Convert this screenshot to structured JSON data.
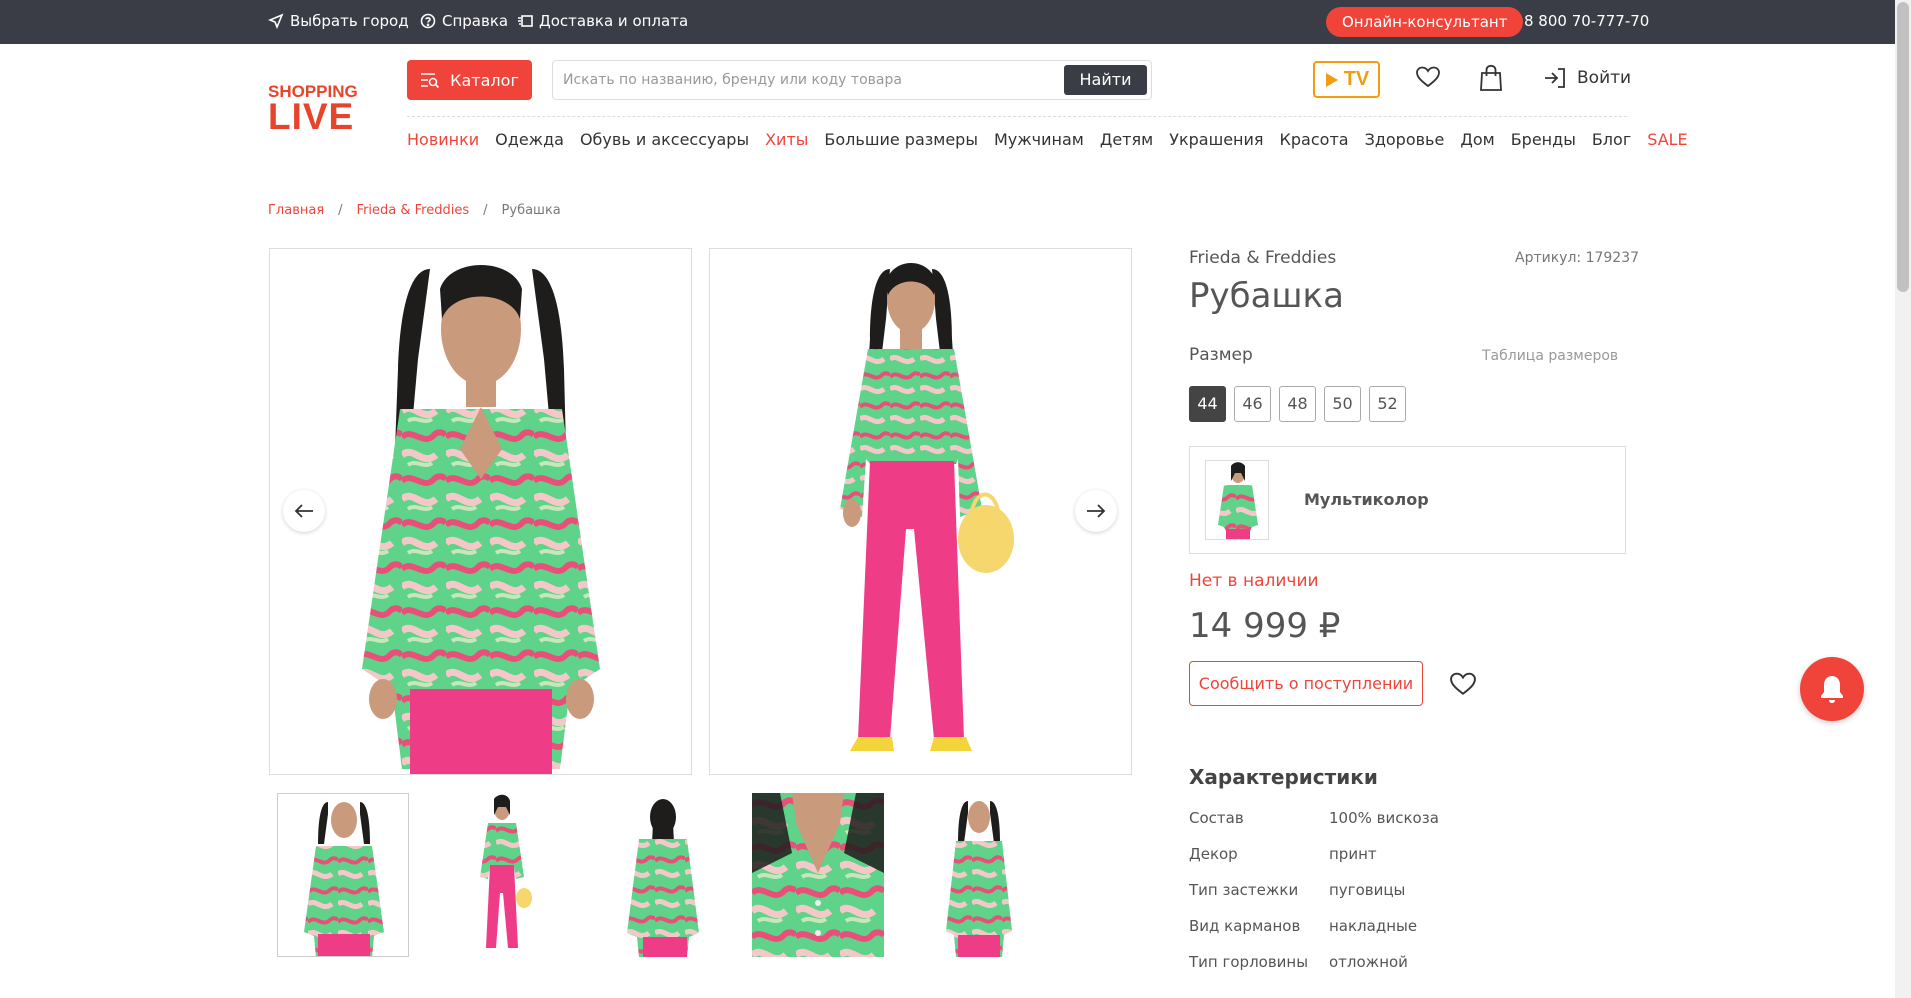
{
  "topbar": {
    "city": "Выбрать город",
    "help": "Справка",
    "delivery": "Доставка и оплата",
    "consultant": "Онлайн-консультант",
    "phone": "8 800 70-777-70"
  },
  "header": {
    "logo_top": "SHOPPING",
    "logo_bottom": "LIVE",
    "catalog": "Каталог",
    "search_placeholder": "Искать по названию, бренду или коду товара",
    "search_button": "Найти",
    "tv_label": "TV",
    "login": "Войти"
  },
  "nav": {
    "items": [
      {
        "label": "Новинки",
        "accent": true
      },
      {
        "label": "Одежда",
        "accent": false
      },
      {
        "label": "Обувь и аксессуары",
        "accent": false
      },
      {
        "label": "Хиты",
        "accent": true
      },
      {
        "label": "Большие размеры",
        "accent": false
      },
      {
        "label": "Мужчинам",
        "accent": false
      },
      {
        "label": "Детям",
        "accent": false
      },
      {
        "label": "Украшения",
        "accent": false
      },
      {
        "label": "Красота",
        "accent": false
      },
      {
        "label": "Здоровье",
        "accent": false
      },
      {
        "label": "Дом",
        "accent": false
      },
      {
        "label": "Бренды",
        "accent": false
      },
      {
        "label": "Блог",
        "accent": false
      },
      {
        "label": "SALE",
        "accent": true
      }
    ]
  },
  "breadcrumb": {
    "home": "Главная",
    "brand": "Frieda & Freddies",
    "current": "Рубашка",
    "sep": "/"
  },
  "product": {
    "brand": "Frieda & Freddies",
    "article": "Артикул: 179237",
    "title": "Рубашка",
    "size_label": "Размер",
    "size_table": "Таблица размеров",
    "sizes": [
      "44",
      "46",
      "48",
      "50",
      "52"
    ],
    "selected_size": "44",
    "color_name": "Мультиколор",
    "stock_status": "Нет в наличии",
    "price": "14 999 ₽",
    "notify_button": "Сообщить о поступлении"
  },
  "characteristics": {
    "title": "Характеристики",
    "rows": [
      {
        "key": "Состав",
        "value": "100% вискоза"
      },
      {
        "key": "Декор",
        "value": "принт"
      },
      {
        "key": "Тип застежки",
        "value": "пуговицы"
      },
      {
        "key": "Вид карманов",
        "value": "накладные"
      },
      {
        "key": "Тип горловины",
        "value": "отложной"
      }
    ]
  },
  "colors": {
    "accent": "#f0443a",
    "topbar": "#3a3d45",
    "tv": "#f39c12",
    "shirt_green": "#5fd38a",
    "shirt_pink": "#e8507a",
    "pants_pink": "#ee3d86"
  }
}
